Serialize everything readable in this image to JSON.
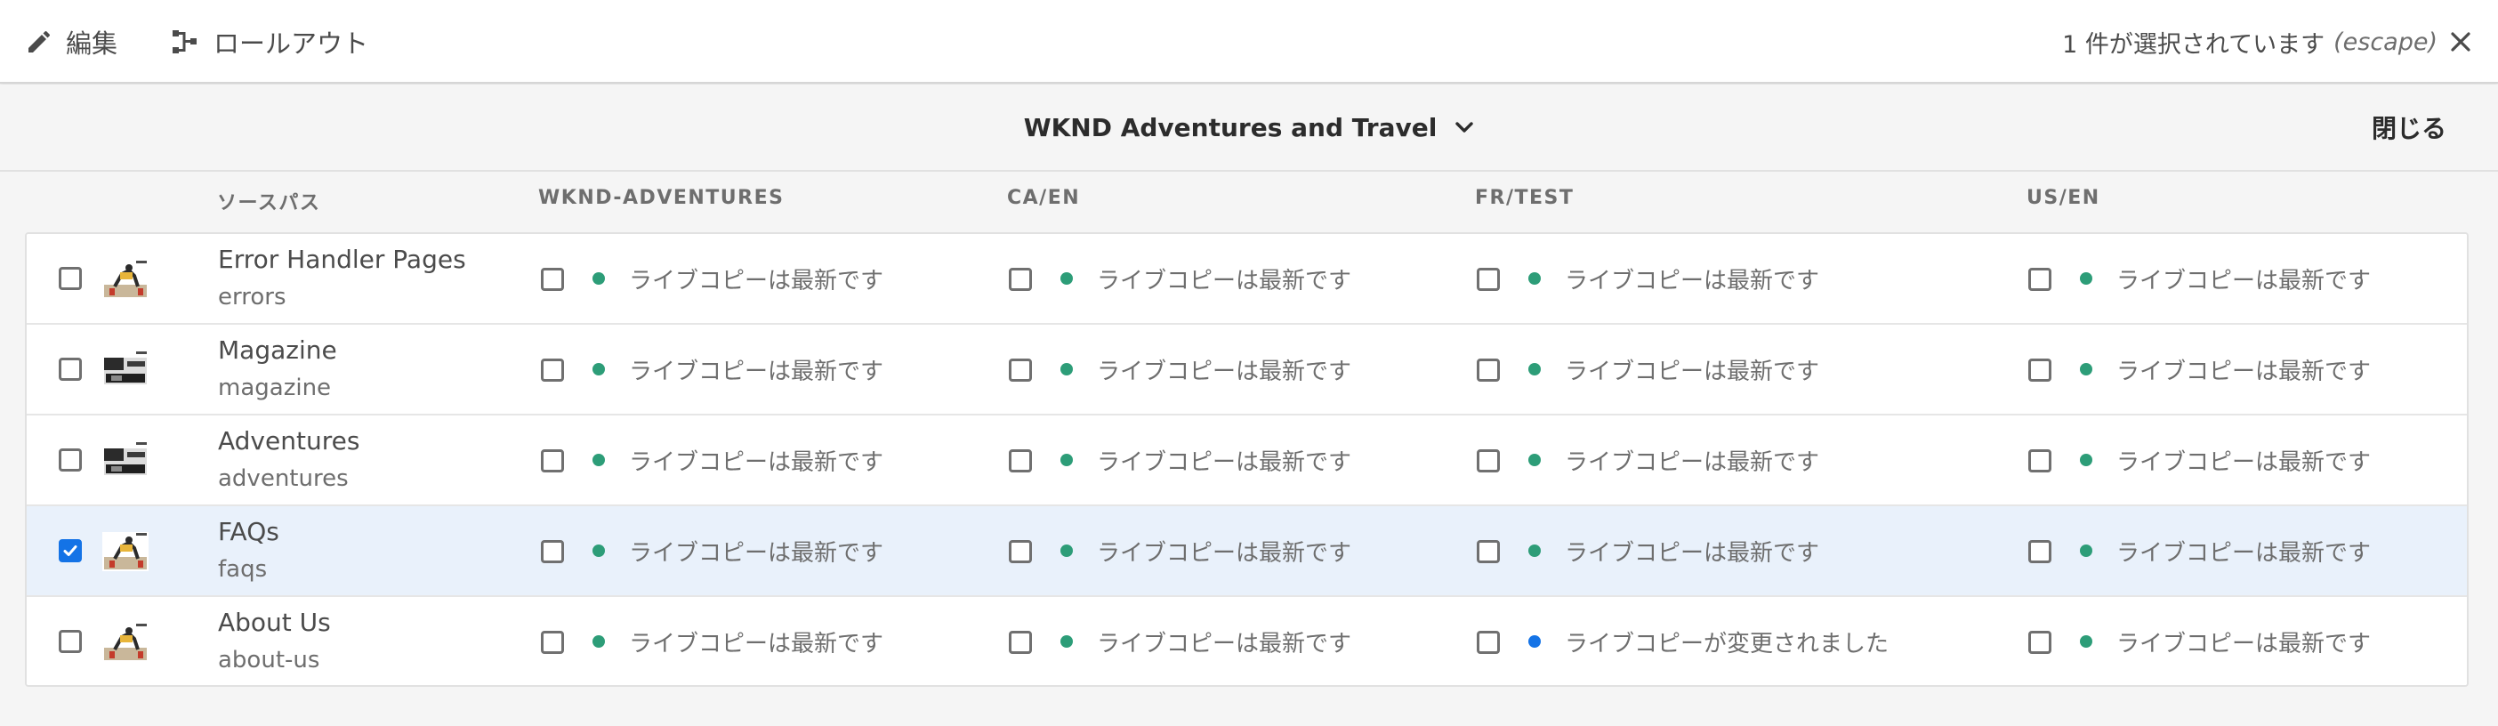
{
  "actionbar": {
    "edit_label": "編集",
    "rollout_label": "ロールアウト",
    "selection_text": "1 件が選択されています",
    "escape_hint": "(escape)"
  },
  "titlebar": {
    "title": "WKND Adventures and Travel",
    "close_label": "閉じる"
  },
  "columns": {
    "source": "ソースパス",
    "c1": "WKND-ADVENTURES",
    "c2": "CA/EN",
    "c3": "FR/TEST",
    "c4": "US/EN"
  },
  "colors": {
    "status_ok": "#2d9d78",
    "status_modified": "#1473e6",
    "selected_row_bg": "#e9f1fb",
    "checkbox_checked": "#1473e6"
  },
  "rows": [
    {
      "title": "Error Handler Pages",
      "path": "errors",
      "selected": false,
      "thumbnail": "cyclist-thumbnail",
      "cells": [
        {
          "text": "ライブコピーは最新です",
          "state": "ok"
        },
        {
          "text": "ライブコピーは最新です",
          "state": "ok"
        },
        {
          "text": "ライブコピーは最新です",
          "state": "ok"
        },
        {
          "text": "ライブコピーは最新です",
          "state": "ok"
        }
      ]
    },
    {
      "title": "Magazine",
      "path": "magazine",
      "selected": false,
      "thumbnail": "magazine-thumbnail",
      "cells": [
        {
          "text": "ライブコピーは最新です",
          "state": "ok"
        },
        {
          "text": "ライブコピーは最新です",
          "state": "ok"
        },
        {
          "text": "ライブコピーは最新です",
          "state": "ok"
        },
        {
          "text": "ライブコピーは最新です",
          "state": "ok"
        }
      ]
    },
    {
      "title": "Adventures",
      "path": "adventures",
      "selected": false,
      "thumbnail": "magazine-thumbnail",
      "cells": [
        {
          "text": "ライブコピーは最新です",
          "state": "ok"
        },
        {
          "text": "ライブコピーは最新です",
          "state": "ok"
        },
        {
          "text": "ライブコピーは最新です",
          "state": "ok"
        },
        {
          "text": "ライブコピーは最新です",
          "state": "ok"
        }
      ]
    },
    {
      "title": "FAQs",
      "path": "faqs",
      "selected": true,
      "thumbnail": "cyclist-thumbnail",
      "cells": [
        {
          "text": "ライブコピーは最新です",
          "state": "ok"
        },
        {
          "text": "ライブコピーは最新です",
          "state": "ok"
        },
        {
          "text": "ライブコピーは最新です",
          "state": "ok"
        },
        {
          "text": "ライブコピーは最新です",
          "state": "ok"
        }
      ]
    },
    {
      "title": "About Us",
      "path": "about-us",
      "selected": false,
      "thumbnail": "cyclist-thumbnail",
      "cells": [
        {
          "text": "ライブコピーは最新です",
          "state": "ok"
        },
        {
          "text": "ライブコピーは最新です",
          "state": "ok"
        },
        {
          "text": "ライブコピーが変更されました",
          "state": "modified"
        },
        {
          "text": "ライブコピーは最新です",
          "state": "ok"
        }
      ]
    }
  ]
}
